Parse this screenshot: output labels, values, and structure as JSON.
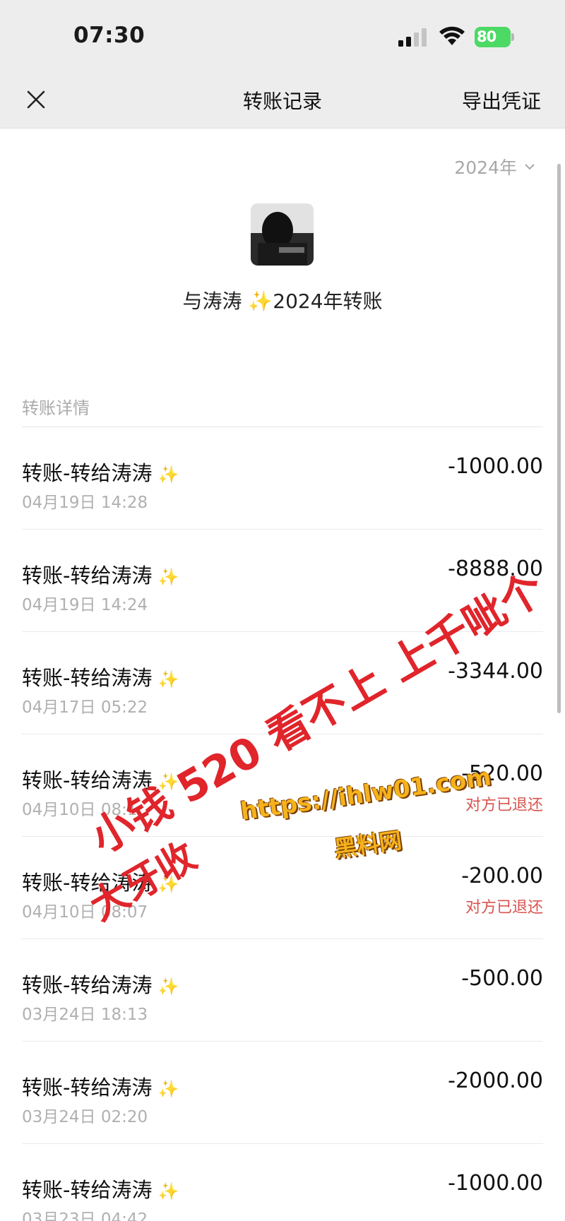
{
  "status_bar": {
    "time": "07:30",
    "battery": "80",
    "signal_icon": "signal-bars-icon",
    "wifi_icon": "wifi-icon"
  },
  "nav": {
    "close_icon": "close-icon",
    "title": "转账记录",
    "export_label": "导出凭证"
  },
  "filter": {
    "year": "2024年"
  },
  "summary": {
    "title": "与涛涛 ✨2024年转账"
  },
  "section_label": "转账详情",
  "transactions": [
    {
      "title": "转账-转给涛涛",
      "date": "04月19日 14:28",
      "amount": "-1000.00",
      "status": ""
    },
    {
      "title": "转账-转给涛涛",
      "date": "04月19日 14:24",
      "amount": "-8888.00",
      "status": ""
    },
    {
      "title": "转账-转给涛涛",
      "date": "04月17日 05:22",
      "amount": "-3344.00",
      "status": ""
    },
    {
      "title": "转账-转给涛涛",
      "date": "04月10日 08:1",
      "amount": "-520.00",
      "status": "对方已退还"
    },
    {
      "title": "转账-转给涛涛",
      "date": "04月10日 08:07",
      "amount": "-200.00",
      "status": "对方已退还"
    },
    {
      "title": "转账-转给涛涛",
      "date": "03月24日 18:13",
      "amount": "-500.00",
      "status": ""
    },
    {
      "title": "转账-转给涛涛",
      "date": "03月24日 02:20",
      "amount": "-2000.00",
      "status": ""
    },
    {
      "title": "转账-转给涛涛",
      "date": "03月23日 04:42",
      "amount": "-1000.00",
      "status": ""
    }
  ],
  "overlay": {
    "red_line1": "小钱 520 看不上 上千呲个",
    "red_line2": "大牙收",
    "url": "https://ihlw01.com",
    "site_name": "黑料网"
  },
  "colors": {
    "nav_bg": "#ededed",
    "refund_red": "#d9534f",
    "battery_green": "#4cd964",
    "watermark_red": "#e0252b",
    "watermark_orange": "#f6b21c"
  }
}
